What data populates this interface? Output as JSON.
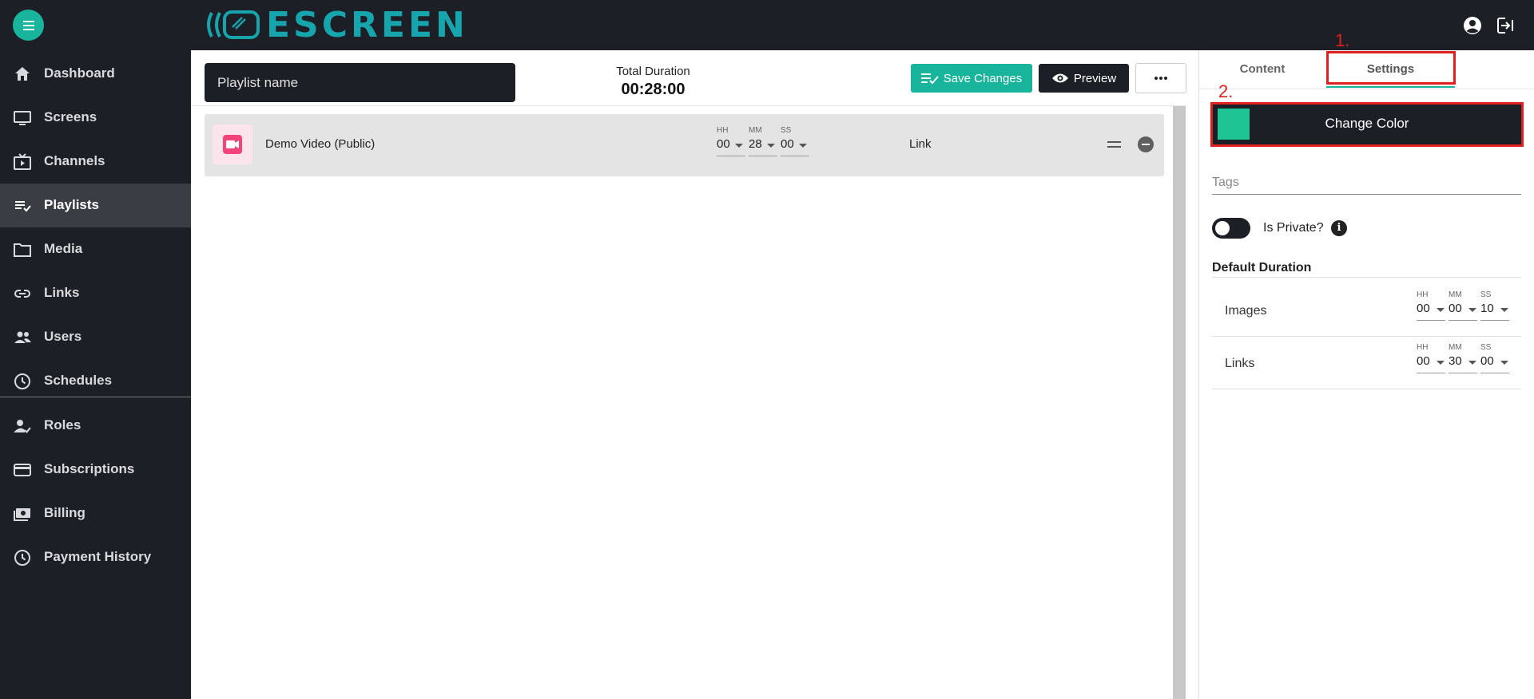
{
  "app": {
    "logo_text": "ESCREEN"
  },
  "sidebar": {
    "items": [
      {
        "label": "Dashboard",
        "icon": "home-icon"
      },
      {
        "label": "Screens",
        "icon": "monitor-icon"
      },
      {
        "label": "Channels",
        "icon": "channel-icon"
      },
      {
        "label": "Playlists",
        "icon": "playlist-icon",
        "active": true
      },
      {
        "label": "Media",
        "icon": "folder-icon"
      },
      {
        "label": "Links",
        "icon": "link-icon"
      },
      {
        "label": "Users",
        "icon": "users-icon"
      },
      {
        "label": "Schedules",
        "icon": "clock-icon"
      },
      {
        "label": "Roles",
        "icon": "role-icon"
      },
      {
        "label": "Subscriptions",
        "icon": "card-icon"
      },
      {
        "label": "Billing",
        "icon": "billing-icon"
      },
      {
        "label": "Payment History",
        "icon": "history-icon"
      }
    ]
  },
  "toolbar": {
    "playlist_name_placeholder": "Playlist name",
    "total_duration_label": "Total Duration",
    "total_duration_value": "00:28:00",
    "save_label": "Save Changes",
    "preview_label": "Preview",
    "more_icon": "more-horizontal-icon"
  },
  "playlist": {
    "items": [
      {
        "title": "Demo Video (Public)",
        "type_icon": "video-camera-icon",
        "hh_label": "HH",
        "hh": "00",
        "mm_label": "MM",
        "mm": "28",
        "ss_label": "SS",
        "ss": "00",
        "link_label": "Link"
      }
    ]
  },
  "panel": {
    "tabs": [
      {
        "label": "Content"
      },
      {
        "label": "Settings",
        "active": true
      }
    ],
    "annotation_1": "1.",
    "annotation_2": "2.",
    "change_color_label": "Change Color",
    "swatch_color": "#1fc495",
    "tags_placeholder": "Tags",
    "is_private_label": "Is Private?",
    "is_private": false,
    "default_duration_title": "Default Duration",
    "durations": [
      {
        "label": "Images",
        "hh_label": "HH",
        "hh": "00",
        "mm_label": "MM",
        "mm": "00",
        "ss_label": "SS",
        "ss": "10"
      },
      {
        "label": "Links",
        "hh_label": "HH",
        "hh": "00",
        "mm_label": "MM",
        "mm": "30",
        "ss_label": "SS",
        "ss": "00"
      }
    ]
  },
  "colors": {
    "accent": "#18b49c",
    "dark": "#1d1f27",
    "highlight": "#e02020"
  }
}
